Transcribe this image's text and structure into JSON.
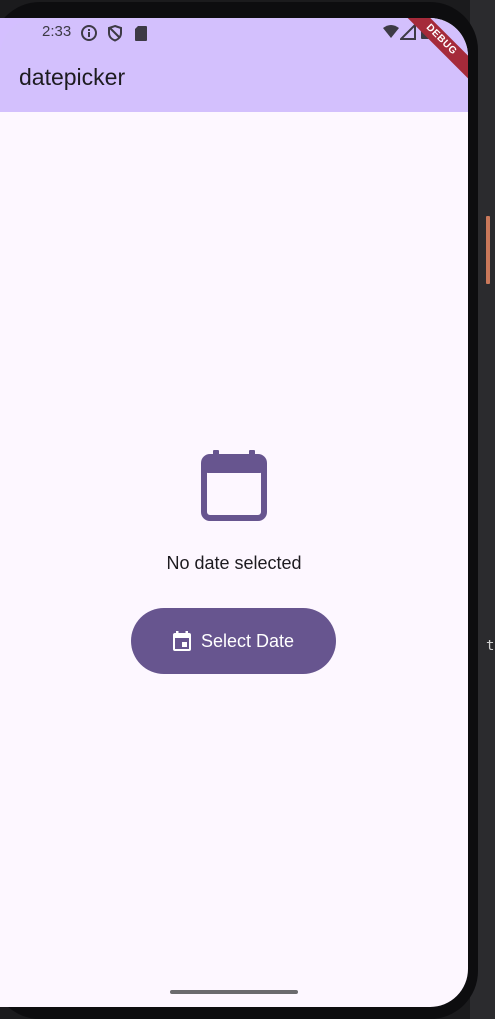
{
  "status_bar": {
    "time": "2:33",
    "icons": [
      "info-icon",
      "shield-icon",
      "sd-card-icon",
      "wifi-icon",
      "signal-icon",
      "battery-icon"
    ]
  },
  "debug_banner": "DEBUG",
  "app_bar": {
    "title": "datepicker"
  },
  "main": {
    "empty_icon": "calendar-icon",
    "message": "No date selected",
    "select_button": {
      "icon": "event-icon",
      "label": "Select Date"
    }
  },
  "side_panel": {
    "text": "t"
  },
  "colors": {
    "app_bar": "#d3c0fd",
    "background": "#fdf7ff",
    "primary": "#67558f",
    "debug_banner": "#a52a3a"
  }
}
